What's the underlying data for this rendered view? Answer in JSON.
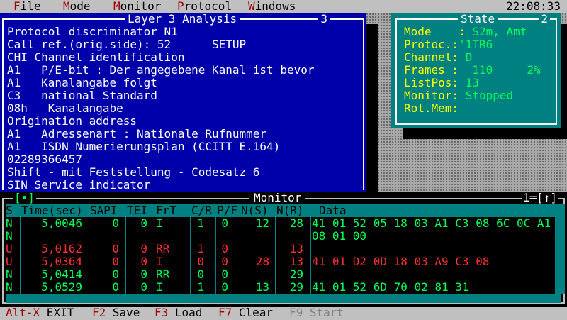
{
  "menu": {
    "items": [
      {
        "hotkey": "F",
        "rest": "ile"
      },
      {
        "hotkey": "M",
        "rest": "ode"
      },
      {
        "hotkey": "M",
        "rest": "onitor"
      },
      {
        "hotkey": "P",
        "rest": "rotocol"
      },
      {
        "hotkey": "W",
        "rest": "indows"
      }
    ],
    "clock": "22:08:33"
  },
  "layer3": {
    "title": "Layer 3 Analysis",
    "number": "3",
    "lines": [
      "Protocol discriminator N1",
      "Call ref.(orig.side): 52      SETUP",
      "CHI Channel identification",
      "A1   P/E-bit : Der angegebene Kanal ist bevor",
      "A1   Kanalangabe folgt",
      "C3   national Standard",
      "08h   Kanalangabe",
      "Origination address",
      "A1   Adressenart : Nationale Rufnummer",
      "A1   ISDN Numerierungsplan (CCITT E.164)",
      "02289366457",
      "Shift - mit Feststellung - Codesatz 6",
      "SIN Service indicator"
    ]
  },
  "state": {
    "title": "State",
    "number": "2",
    "rows": [
      {
        "label": "Mode    : ",
        "value": "S2m, Amt"
      },
      {
        "label": "Protoc.:",
        "value": "'1TR6"
      },
      {
        "label": "Channel: ",
        "value": "D"
      },
      {
        "label": "Frames : ",
        "value": " 110     2%"
      },
      {
        "label": "ListPos: ",
        "value": "13"
      },
      {
        "label": "Monitor: ",
        "value": "Stopped"
      },
      {
        "label": "Rot.Mem: ",
        "value": ""
      }
    ]
  },
  "monitor": {
    "title": "Monitor",
    "left_tag": "[•]",
    "right_tag": "1═[↑]",
    "columns": [
      "S",
      "Time(sec)",
      "SAPI",
      "TEI",
      "FrT",
      "C/R",
      "P/F",
      "N(S)",
      "N(R)",
      "Data"
    ],
    "rows": [
      {
        "s": "N",
        "time": "5,0046",
        "sapi": "0",
        "tei": "0",
        "frt": "I",
        "cr": "1",
        "pf": "0",
        "ns": "12",
        "nr": "28",
        "data": "41 01 52 05 18 03 A1 C3 08 6C 0C A1",
        "color": "g"
      },
      {
        "s": "N",
        "time": "",
        "sapi": "",
        "tei": "",
        "frt": "",
        "cr": "",
        "pf": "",
        "ns": "",
        "nr": "",
        "data": "08 01 00",
        "color": "g"
      },
      {
        "s": "U",
        "time": "5,0162",
        "sapi": "0",
        "tei": "0",
        "frt": "RR",
        "cr": "1",
        "pf": "0",
        "ns": "",
        "nr": "13",
        "data": "",
        "color": "r"
      },
      {
        "s": "U",
        "time": "5,0364",
        "sapi": "0",
        "tei": "0",
        "frt": "I",
        "cr": "0",
        "pf": "0",
        "ns": "28",
        "nr": "13",
        "data": "41 01 D2 0D 18 03 A9 C3 08",
        "color": "r"
      },
      {
        "s": "N",
        "time": "5,0414",
        "sapi": "0",
        "tei": "0",
        "frt": "RR",
        "cr": "0",
        "pf": "0",
        "ns": "",
        "nr": "29",
        "data": "",
        "color": "g"
      },
      {
        "s": "N",
        "time": "5,0529",
        "sapi": "0",
        "tei": "0",
        "frt": "I",
        "cr": "1",
        "pf": "0",
        "ns": "13",
        "nr": "29",
        "data": "41 01 52 6D 70 02 81 31",
        "color": "g"
      }
    ]
  },
  "fkeys": [
    {
      "key": "Alt-X",
      "label": " EXIT",
      "disabled": false
    },
    {
      "key": "F2",
      "label": " Save",
      "disabled": false
    },
    {
      "key": "F3",
      "label": " Load",
      "disabled": false
    },
    {
      "key": "F7",
      "label": " Clear",
      "disabled": false
    },
    {
      "key": "F9",
      "label": " Start",
      "disabled": true
    }
  ],
  "colors": {
    "window_blue": "#0000aa",
    "state_teal": "#008080",
    "green": "#00ff55",
    "red": "#ff3030",
    "yellow": "#ffff00"
  }
}
